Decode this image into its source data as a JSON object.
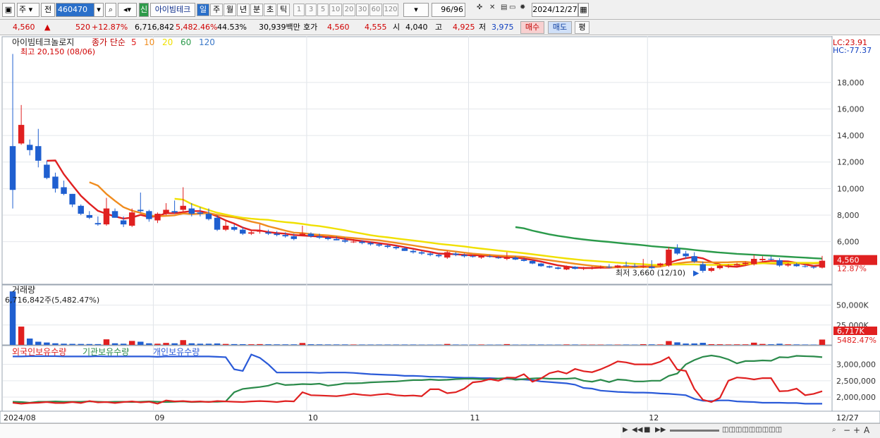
{
  "toolbar": {
    "market_label": "주",
    "prev_label": "전",
    "code": "460470",
    "new_badge": "신",
    "stock_name": "아이빔테크",
    "periods": [
      "일",
      "주",
      "월",
      "년",
      "분",
      "초",
      "틱"
    ],
    "active_period": "일",
    "intervals": [
      "1",
      "3",
      "5",
      "10",
      "20",
      "30",
      "60",
      "120"
    ],
    "count": "96/96",
    "date": "2024/12/27"
  },
  "quote": {
    "price": "4,560",
    "change": "520",
    "change_pct": "+12.87%",
    "volume": "6,716,842",
    "volume_ratio": "5,482.46%",
    "turnover": "44.53%",
    "amount": "30,939백만",
    "bid_label": "호가",
    "bid1": "4,560",
    "bid2": "4,555",
    "open_label": "시",
    "open": "4,040",
    "high_label": "고",
    "high": "4,925",
    "low_label": "저",
    "low": "3,975",
    "buy_label": "매수",
    "sell_label": "매도",
    "eval_label": "평"
  },
  "price_panel": {
    "title": "아이빔테크놀로지",
    "ma_label": "종가 단순",
    "ma_periods": [
      {
        "p": "5",
        "color": "#e02020"
      },
      {
        "p": "10",
        "color": "#f08c1e"
      },
      {
        "p": "20",
        "color": "#f0e000"
      },
      {
        "p": "60",
        "color": "#2a9a4a"
      },
      {
        "p": "120",
        "color": "#3a78c8"
      }
    ],
    "high_note": "최고 20,150 (08/06)",
    "low_note": "최저 3,660 (12/10)",
    "lc": "LC:23.91",
    "hc": "HC:-77.37",
    "y_ticks": [
      "18,000",
      "16,000",
      "14,000",
      "12,000",
      "10,000",
      "8,000",
      "6,000"
    ],
    "price_tag": "4,560",
    "pct_tag": "12.87%"
  },
  "volume_panel": {
    "title": "거래량",
    "value_note": "6,716,842주(5,482.47%)",
    "y_ticks": [
      "50,000K",
      "25,000K"
    ],
    "vol_tag": "6,717K",
    "pct_tag": "5482.47%"
  },
  "holder_panel": {
    "series": [
      {
        "name": "외국인보유수량",
        "color": "#e02020"
      },
      {
        "name": "기관보유수량",
        "color": "#2a8a4a"
      },
      {
        "name": "개인보유수량",
        "color": "#2a5ad8"
      }
    ],
    "y_ticks": [
      "3,000,000",
      "2,500,000",
      "2,000,000"
    ]
  },
  "x_axis": {
    "labels": [
      "2024/08",
      "09",
      "10",
      "11",
      "12",
      "12/27"
    ]
  },
  "chart_data": {
    "type": "candlestick",
    "x": [
      "2024/08",
      "09",
      "10",
      "11",
      "12",
      "12/27"
    ],
    "candles": [
      [
        13200,
        20150,
        8500,
        9900
      ],
      [
        13400,
        16300,
        13300,
        14800
      ],
      [
        13300,
        13700,
        12500,
        12900
      ],
      [
        13200,
        14500,
        11600,
        12100
      ],
      [
        11800,
        12100,
        10700,
        10800
      ],
      [
        10900,
        11200,
        9700,
        10000
      ],
      [
        10100,
        10600,
        9500,
        9600
      ],
      [
        9600,
        9600,
        8600,
        8800
      ],
      [
        8700,
        8800,
        8000,
        8100
      ],
      [
        8000,
        8300,
        7700,
        7800
      ],
      [
        7400,
        7900,
        7200,
        7300
      ],
      [
        7300,
        9300,
        7200,
        8500
      ],
      [
        8300,
        8500,
        7800,
        7800
      ],
      [
        7600,
        7900,
        7100,
        7300
      ],
      [
        7200,
        8500,
        7100,
        8200
      ],
      [
        8400,
        9700,
        8200,
        8300
      ],
      [
        8300,
        8400,
        7500,
        7700
      ],
      [
        7600,
        8200,
        7400,
        8100
      ],
      [
        8100,
        8900,
        8000,
        8400
      ],
      [
        8300,
        9100,
        8100,
        8200
      ],
      [
        8400,
        10100,
        8200,
        8700
      ],
      [
        8500,
        8900,
        7900,
        8100
      ],
      [
        8200,
        8600,
        7900,
        8100
      ],
      [
        8100,
        8500,
        7600,
        7700
      ],
      [
        7800,
        8000,
        6800,
        6900
      ],
      [
        6900,
        7600,
        6800,
        7200
      ],
      [
        7100,
        7300,
        6800,
        6900
      ],
      [
        6900,
        7100,
        6500,
        6600
      ],
      [
        6600,
        6900,
        6500,
        6700
      ],
      [
        6800,
        7300,
        6600,
        6800
      ],
      [
        6700,
        6900,
        6500,
        6600
      ],
      [
        6600,
        6800,
        6400,
        6500
      ],
      [
        6500,
        6700,
        6300,
        6400
      ],
      [
        6400,
        6600,
        6100,
        6200
      ],
      [
        6500,
        7200,
        6400,
        6600
      ],
      [
        6600,
        6700,
        6300,
        6400
      ],
      [
        6400,
        6600,
        6200,
        6300
      ],
      [
        6300,
        6400,
        6100,
        6200
      ],
      [
        6200,
        6400,
        6100,
        6100
      ],
      [
        6100,
        6300,
        5900,
        6000
      ],
      [
        6000,
        6200,
        5900,
        6000
      ],
      [
        6000,
        6100,
        5800,
        5900
      ],
      [
        5900,
        6000,
        5700,
        5800
      ],
      [
        5800,
        5900,
        5600,
        5700
      ],
      [
        5700,
        5800,
        5500,
        5600
      ],
      [
        5600,
        5700,
        5400,
        5500
      ],
      [
        5500,
        5600,
        5300,
        5300
      ],
      [
        5300,
        5400,
        5100,
        5200
      ],
      [
        5200,
        5300,
        5000,
        5100
      ],
      [
        5100,
        5200,
        4900,
        5000
      ],
      [
        5000,
        5100,
        4800,
        4900
      ],
      [
        4800,
        5300,
        4700,
        5200
      ],
      [
        5100,
        5200,
        4900,
        5000
      ],
      [
        5000,
        5100,
        4800,
        4900
      ],
      [
        4900,
        5000,
        4800,
        4850
      ],
      [
        4800,
        5000,
        4700,
        4950
      ],
      [
        4900,
        5000,
        4800,
        4850
      ],
      [
        4800,
        4900,
        4700,
        4750
      ],
      [
        4700,
        5200,
        4600,
        4800
      ],
      [
        4800,
        4900,
        4600,
        4650
      ],
      [
        4650,
        4800,
        4500,
        4550
      ],
      [
        4550,
        4600,
        4300,
        4350
      ],
      [
        4350,
        4400,
        4100,
        4150
      ],
      [
        4150,
        4200,
        4000,
        4050
      ],
      [
        4050,
        4100,
        3900,
        3950
      ],
      [
        3900,
        4200,
        3850,
        4100
      ],
      [
        4100,
        4150,
        3900,
        3950
      ],
      [
        3950,
        4100,
        3850,
        4000
      ],
      [
        4000,
        4150,
        3900,
        4050
      ],
      [
        4050,
        4200,
        3950,
        4100
      ],
      [
        4100,
        4300,
        4000,
        4050
      ],
      [
        4050,
        4250,
        4000,
        4200
      ],
      [
        4200,
        4500,
        4100,
        4150
      ],
      [
        4150,
        4350,
        4050,
        4100
      ],
      [
        4100,
        4700,
        4000,
        4150
      ],
      [
        4100,
        4600,
        3950,
        4000
      ],
      [
        4200,
        4400,
        4100,
        4350
      ],
      [
        4200,
        5600,
        4100,
        5400
      ],
      [
        5500,
        5800,
        5000,
        5100
      ],
      [
        5100,
        5300,
        4700,
        4900
      ],
      [
        4900,
        5200,
        4400,
        4500
      ],
      [
        4300,
        4500,
        3660,
        3800
      ],
      [
        3800,
        4100,
        3700,
        4000
      ],
      [
        4000,
        4300,
        3900,
        4200
      ],
      [
        4100,
        4300,
        4000,
        4200
      ],
      [
        4200,
        4400,
        4100,
        4300
      ],
      [
        4300,
        4500,
        4200,
        4400
      ],
      [
        4300,
        5000,
        4200,
        4700
      ],
      [
        4600,
        4900,
        4500,
        4700
      ],
      [
        4700,
        4900,
        4600,
        4650
      ],
      [
        4600,
        4750,
        4100,
        4200
      ],
      [
        4200,
        4400,
        4100,
        4300
      ],
      [
        4300,
        4400,
        4100,
        4150
      ],
      [
        4150,
        4300,
        4050,
        4100
      ],
      [
        4100,
        4200,
        3950,
        4040
      ],
      [
        4040,
        4925,
        3975,
        4560
      ]
    ],
    "volume_k": [
      67168,
      23000,
      8000,
      4000,
      3000,
      2000,
      1500,
      1300,
      1200,
      1100,
      1000,
      7000,
      2000,
      1500,
      5000,
      4000,
      2000,
      1500,
      2500,
      2000,
      6000,
      2000,
      1500,
      1500,
      1800,
      1200,
      1000,
      900,
      800,
      1000,
      800,
      700,
      700,
      700,
      2400,
      800,
      700,
      600,
      600,
      600,
      500,
      500,
      500,
      500,
      500,
      500,
      500,
      500,
      400,
      400,
      400,
      1200,
      500,
      400,
      400,
      500,
      400,
      400,
      1000,
      400,
      400,
      500,
      500,
      400,
      400,
      600,
      500,
      400,
      400,
      400,
      400,
      400,
      500,
      400,
      900,
      700,
      600,
      4800,
      3200,
      1700,
      1800,
      2600,
      900,
      800,
      600,
      700,
      700,
      2800,
      1200,
      800,
      1500,
      700,
      600,
      500,
      400,
      6717
    ],
    "holders": {
      "foreign": [
        1830,
        1800,
        1820,
        1830,
        1850,
        1820,
        1820,
        1850,
        1820,
        1880,
        1840,
        1850,
        1820,
        1850,
        1870,
        1840,
        1860,
        1800,
        1900,
        1870,
        1880,
        1860,
        1870,
        1850,
        1880,
        1870,
        1860,
        1850,
        1870,
        1880,
        1870,
        1850,
        1880,
        1870,
        2150,
        2060,
        2050,
        2040,
        2030,
        2060,
        2100,
        2070,
        2050,
        2080,
        2100,
        2060,
        2040,
        2050,
        2030,
        2240,
        2240,
        2120,
        2150,
        2260,
        2450,
        2480,
        2550,
        2500,
        2600,
        2590,
        2700,
        2470,
        2570,
        2730,
        2790,
        2720,
        2860,
        2790,
        2760,
        2850,
        2960,
        3090,
        3060,
        3000,
        3000,
        3000,
        3080,
        3220,
        2840,
        2800,
        2250,
        1920,
        1850,
        1980,
        2500,
        2600,
        2580,
        2540,
        2580,
        2580,
        2180,
        2190,
        2260,
        2060,
        2100,
        2180
      ],
      "institution": [
        1860,
        1850,
        1830,
        1860,
        1860,
        1870,
        1860,
        1860,
        1860,
        1870,
        1860,
        1850,
        1860,
        1860,
        1850,
        1860,
        1870,
        1860,
        1850,
        1860,
        1870,
        1850,
        1860,
        1860,
        1860,
        1870,
        2150,
        2250,
        2280,
        2310,
        2350,
        2430,
        2370,
        2380,
        2400,
        2390,
        2410,
        2350,
        2380,
        2420,
        2420,
        2430,
        2450,
        2460,
        2470,
        2480,
        2500,
        2520,
        2520,
        2540,
        2520,
        2530,
        2550,
        2560,
        2560,
        2550,
        2540,
        2570,
        2580,
        2530,
        2550,
        2570,
        2580,
        2560,
        2560,
        2560,
        2580,
        2500,
        2470,
        2530,
        2460,
        2540,
        2520,
        2480,
        2480,
        2500,
        2500,
        2650,
        2720,
        3000,
        3130,
        3230,
        3270,
        3230,
        3150,
        3030,
        3100,
        3100,
        3120,
        3110,
        3220,
        3210,
        3260,
        3250,
        3240,
        3220
      ],
      "individual": [
        3240,
        3240,
        3250,
        3250,
        3250,
        3250,
        3240,
        3240,
        3240,
        3240,
        3250,
        3240,
        3240,
        3240,
        3240,
        3240,
        3240,
        3230,
        3240,
        3240,
        3240,
        3240,
        3240,
        3240,
        3230,
        3220,
        2850,
        2800,
        3300,
        3200,
        3000,
        2750,
        2750,
        2750,
        2750,
        2750,
        2740,
        2750,
        2750,
        2750,
        2740,
        2720,
        2700,
        2690,
        2680,
        2670,
        2650,
        2650,
        2640,
        2620,
        2620,
        2610,
        2600,
        2590,
        2590,
        2580,
        2580,
        2570,
        2560,
        2550,
        2540,
        2520,
        2480,
        2460,
        2440,
        2420,
        2380,
        2280,
        2260,
        2200,
        2180,
        2160,
        2150,
        2140,
        2140,
        2130,
        2110,
        2100,
        2080,
        2060,
        1950,
        1890,
        1880,
        1900,
        1900,
        1870,
        1860,
        1850,
        1830,
        1830,
        1830,
        1820,
        1820,
        1800,
        1800,
        1800
      ]
    }
  },
  "status": {
    "icons": [
      "play-icon",
      "rewind-icon",
      "stop-icon",
      "fast-forward-icon"
    ]
  }
}
